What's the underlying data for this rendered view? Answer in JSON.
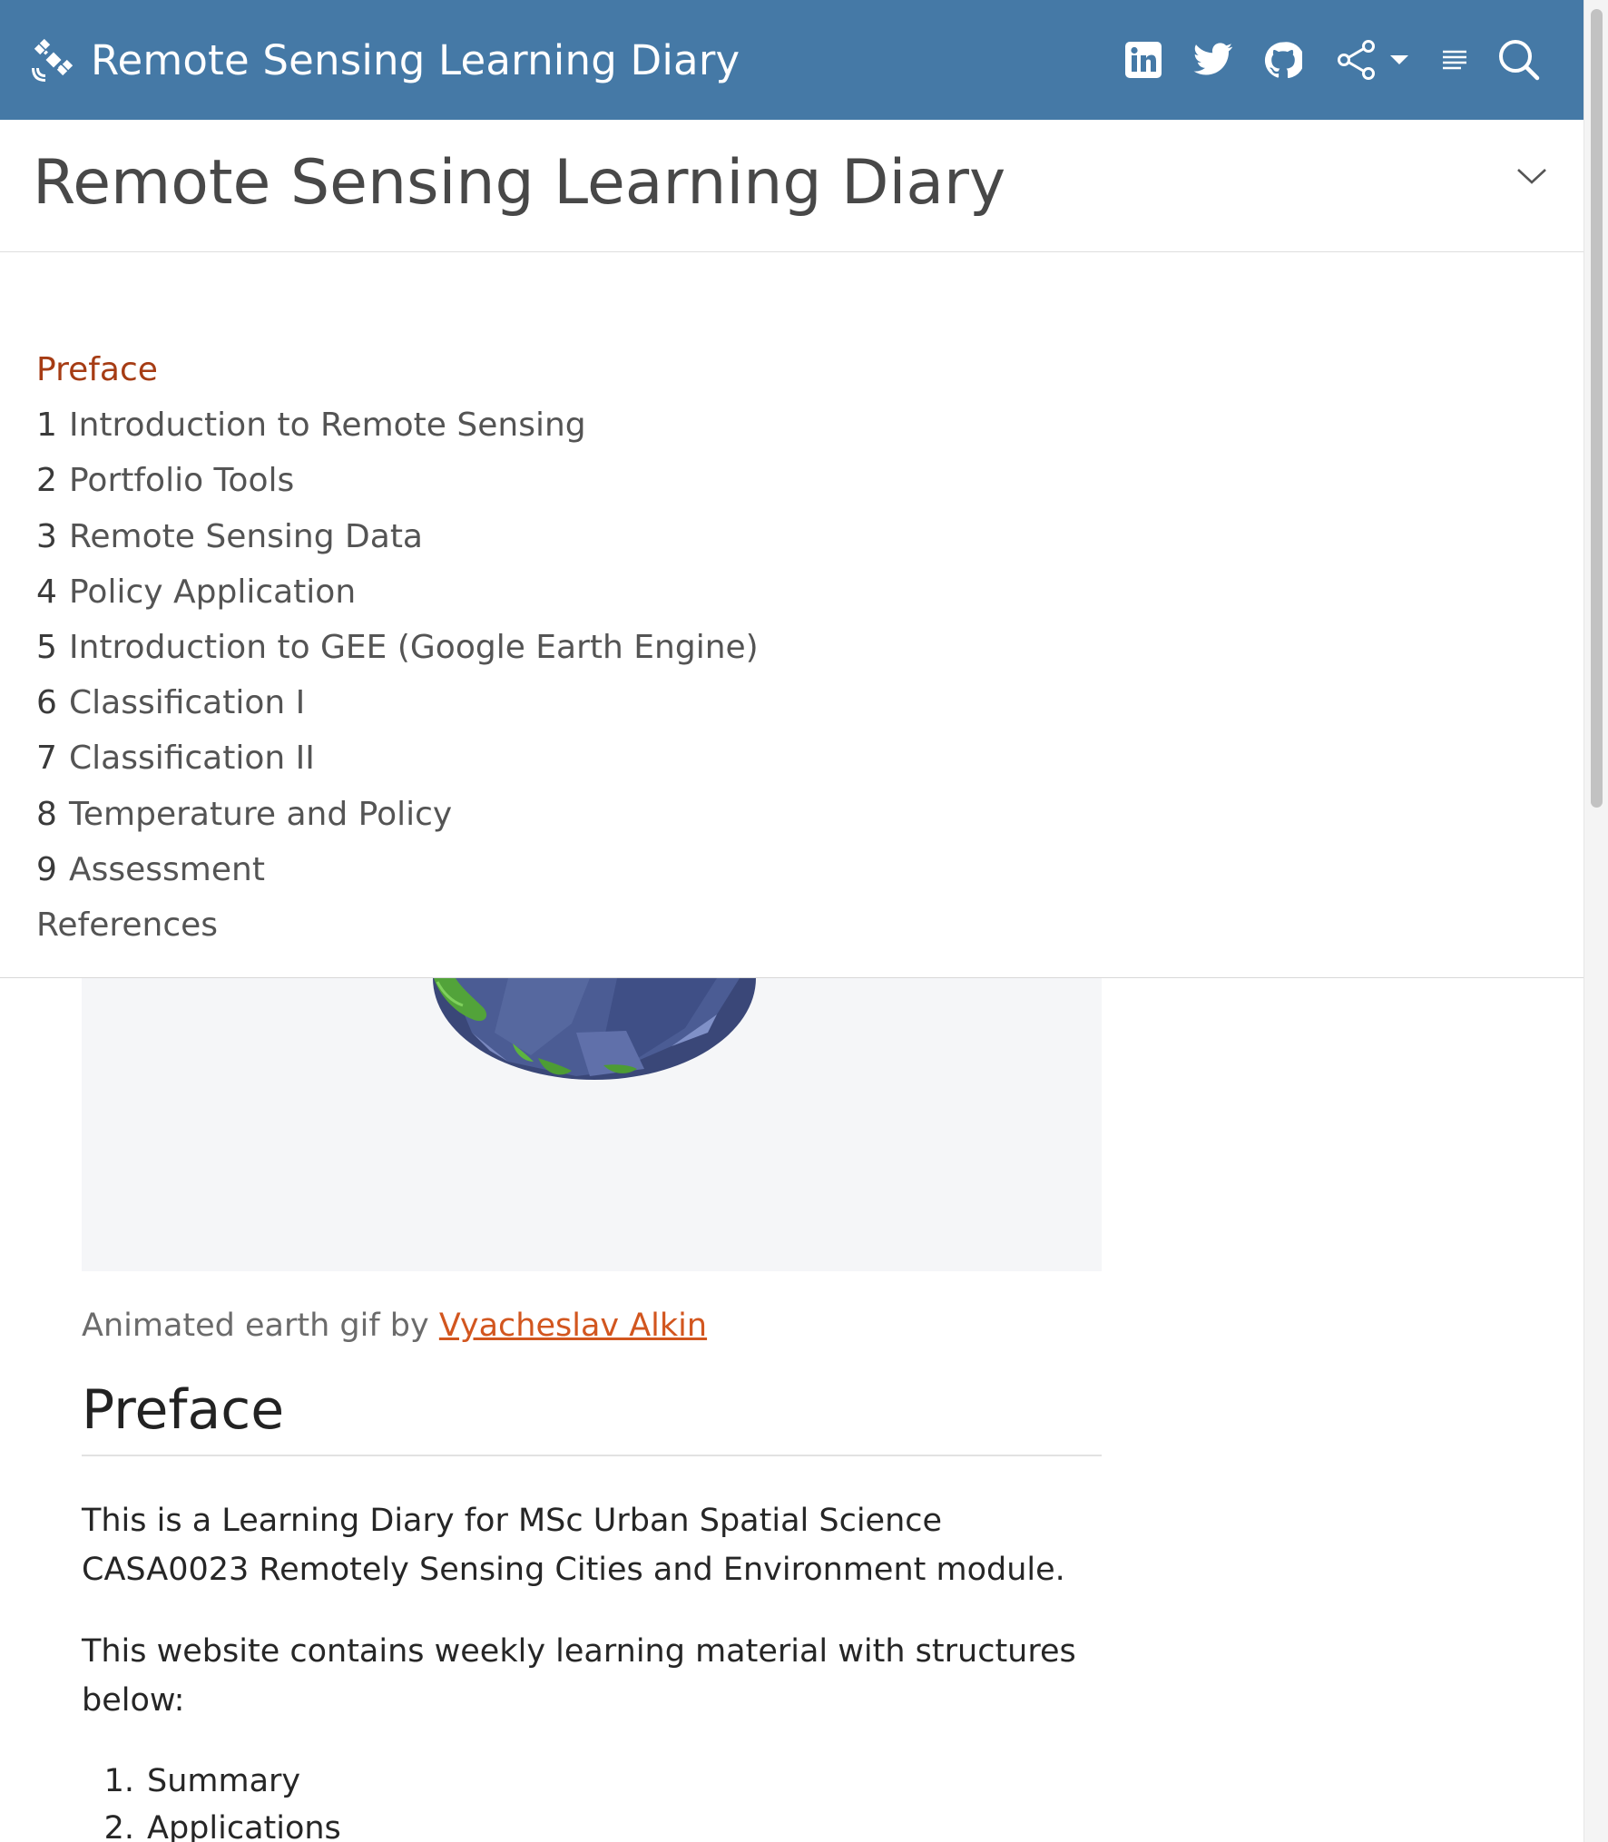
{
  "navbar": {
    "title": "Remote Sensing Learning Diary",
    "icons": [
      "satellite-icon",
      "linkedin-icon",
      "twitter-icon",
      "github-icon",
      "share-icon",
      "caret-down-icon",
      "toc-lines-icon",
      "search-icon"
    ],
    "color": "#4579a6"
  },
  "subheader": {
    "title": "Remote Sensing Learning Diary",
    "icon": "chevron-down-icon"
  },
  "toc": {
    "items": [
      {
        "num": "",
        "label": "Preface",
        "active": true
      },
      {
        "num": "1",
        "label": "Introduction to Remote Sensing"
      },
      {
        "num": "2",
        "label": "Portfolio Tools"
      },
      {
        "num": "3",
        "label": "Remote Sensing Data"
      },
      {
        "num": "4",
        "label": "Policy Application"
      },
      {
        "num": "5",
        "label": "Introduction to GEE (Google Earth Engine)"
      },
      {
        "num": "6",
        "label": "Classification I"
      },
      {
        "num": "7",
        "label": "Classification II"
      },
      {
        "num": "8",
        "label": "Temperature and Policy"
      },
      {
        "num": "9",
        "label": "Assessment"
      },
      {
        "num": "",
        "label": "References"
      }
    ],
    "active_color": "#a63c14"
  },
  "content": {
    "caption_prefix": "Animated earth gif by",
    "caption_link": "Vyacheslav Alkin",
    "heading": "Preface",
    "paragraphs": [
      "This is a Learning Diary for MSc Urban Spatial Science CASA0023 Remotely Sensing Cities and Environment module.",
      "This website contains weekly learning material with structures below:"
    ],
    "list": [
      {
        "num": "1.",
        "label": "Summary"
      },
      {
        "num": "2.",
        "label": "Applications"
      }
    ],
    "link_color": "#d2561f"
  }
}
